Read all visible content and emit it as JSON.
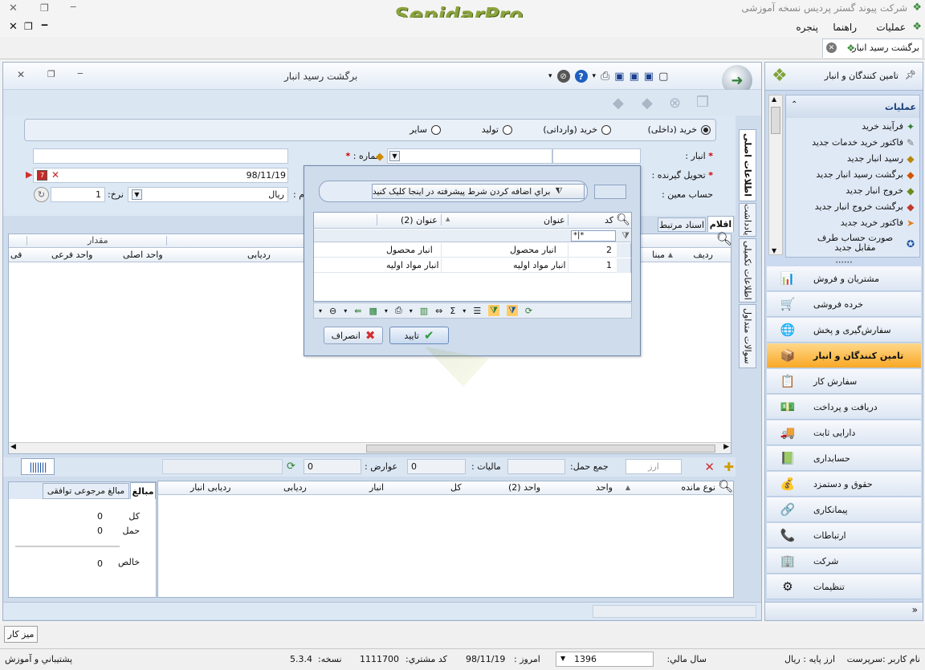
{
  "app": {
    "logo_text": "SepidarPro",
    "company_title": "شرکت پیوند گستر پردیس نسخه آموزشی"
  },
  "menu": [
    "عملیات",
    "راهنما",
    "پنجره"
  ],
  "doc_tab": {
    "label": "برگشت رسید انبار"
  },
  "window": {
    "title": "برگشت رسید انبار"
  },
  "form": {
    "purchase_types": [
      {
        "label": "خرید (داخلی)",
        "checked": true
      },
      {
        "label": "خرید (وارداتی)",
        "checked": false
      },
      {
        "label": "تولید",
        "checked": false
      },
      {
        "label": "سایر",
        "checked": false
      }
    ],
    "warehouse_label": "انبار :",
    "number_label": "شماره :",
    "receiver_label": "تحویل گیرنده :",
    "date_value": "98/11/19",
    "account_label": "حساب معین :",
    "currency_value": "ریال",
    "currency_label_partial": "م :",
    "rate_label": "نرخ:",
    "rate_value": "1",
    "required_mark": "*"
  },
  "side_tabs": [
    "اطلاعات اصلی",
    "یادداشت",
    "اطلاعات تکمیلی",
    "سوالات متداول"
  ],
  "items_tabs": [
    "اقلام",
    "اسناد مرتبط"
  ],
  "upper_grid": {
    "group_header": "مقدار",
    "columns": [
      "ردیف",
      "مبنا",
      "ردیابی",
      "واحد اصلی",
      "واحد فرعی",
      "فی"
    ]
  },
  "totals": {
    "shipping_label": "جمع حمل:",
    "tax_label": "مالیات :",
    "tax_value": "0",
    "duties_label": "عوارض :",
    "duties_value": "0",
    "currency_placeholder": "ارز"
  },
  "lower_grid": {
    "columns": [
      "نوع مانده",
      "واحد",
      "واحد (2)",
      "کل",
      "انبار",
      "ردیابی",
      "ردیابی انبار"
    ]
  },
  "amounts_panel": {
    "tabs": [
      "مبالغ",
      "مبالغ مرجوعی توافقی"
    ],
    "rows": [
      {
        "label": "کل",
        "value": "0"
      },
      {
        "label": "حمل",
        "value": "0"
      },
      {
        "label": "خالص",
        "value": "0"
      }
    ]
  },
  "dialog": {
    "advanced_filter_text": "براي اضافه کردن شرط پيشرفته در اينجا کليک کنيد",
    "columns": [
      "کد",
      "عنوان",
      "عنوان (2)"
    ],
    "filter_text": "*|*",
    "rows": [
      {
        "code": "2",
        "title": "انبار محصول",
        "title2": "انبار محصول"
      },
      {
        "code": "1",
        "title": "انبار مواد اولیه",
        "title2": "انبار مواد اولیه"
      }
    ],
    "ok_label": "تایید",
    "cancel_label": "انصراف"
  },
  "right_panel": {
    "header": "تامین کنندگان و انبار",
    "ops_title": "عملیات",
    "ops": [
      "فرآیند خرید",
      "فاکتور خرید خدمات جدید",
      "رسید انبار جدید",
      "برگشت رسید انبار جدید",
      "خروج انبار جدید",
      "برگشت خروج انبار جدید",
      "فاکتور خرید جدید",
      "صورت حساب طرف مقابل جدید"
    ],
    "nav": [
      {
        "label": "مشتریان و فروش",
        "icon": "📊",
        "active": false
      },
      {
        "label": "خرده فروشی",
        "icon": "🛒",
        "active": false
      },
      {
        "label": "سفارش‌گیری و پخش",
        "icon": "🌐",
        "active": false
      },
      {
        "label": "تامین کنندگان و انبار",
        "icon": "📦",
        "active": true
      },
      {
        "label": "سفارش کار",
        "icon": "📋",
        "active": false
      },
      {
        "label": "دریافت و پرداخت",
        "icon": "💵",
        "active": false
      },
      {
        "label": "دارایی ثابت",
        "icon": "🚚",
        "active": false
      },
      {
        "label": "حسابداری",
        "icon": "📗",
        "active": false
      },
      {
        "label": "حقوق و دستمزد",
        "icon": "💰",
        "active": false
      },
      {
        "label": "پیمانکاری",
        "icon": "🔗",
        "active": false
      },
      {
        "label": "ارتباطات",
        "icon": "📞",
        "active": false
      },
      {
        "label": "شرکت",
        "icon": "🏢",
        "active": false
      },
      {
        "label": "تنظیمات",
        "icon": "⚙",
        "active": false
      }
    ]
  },
  "desk_button": "میز کار",
  "status": {
    "user": "نام کاربر :سرپرست",
    "base_currency": "ارز پایه :  ریال",
    "fiscal_year_label": "سال مالي:",
    "fiscal_year_value": "1396",
    "today_label": "امروز :",
    "today_value": "98/11/19",
    "customer_code_label": "کد مشتري:",
    "customer_code_value": "1111700",
    "version_label": "نسخه:",
    "version_value": "5.3.4",
    "support": "پشتيباني و آموزش"
  }
}
